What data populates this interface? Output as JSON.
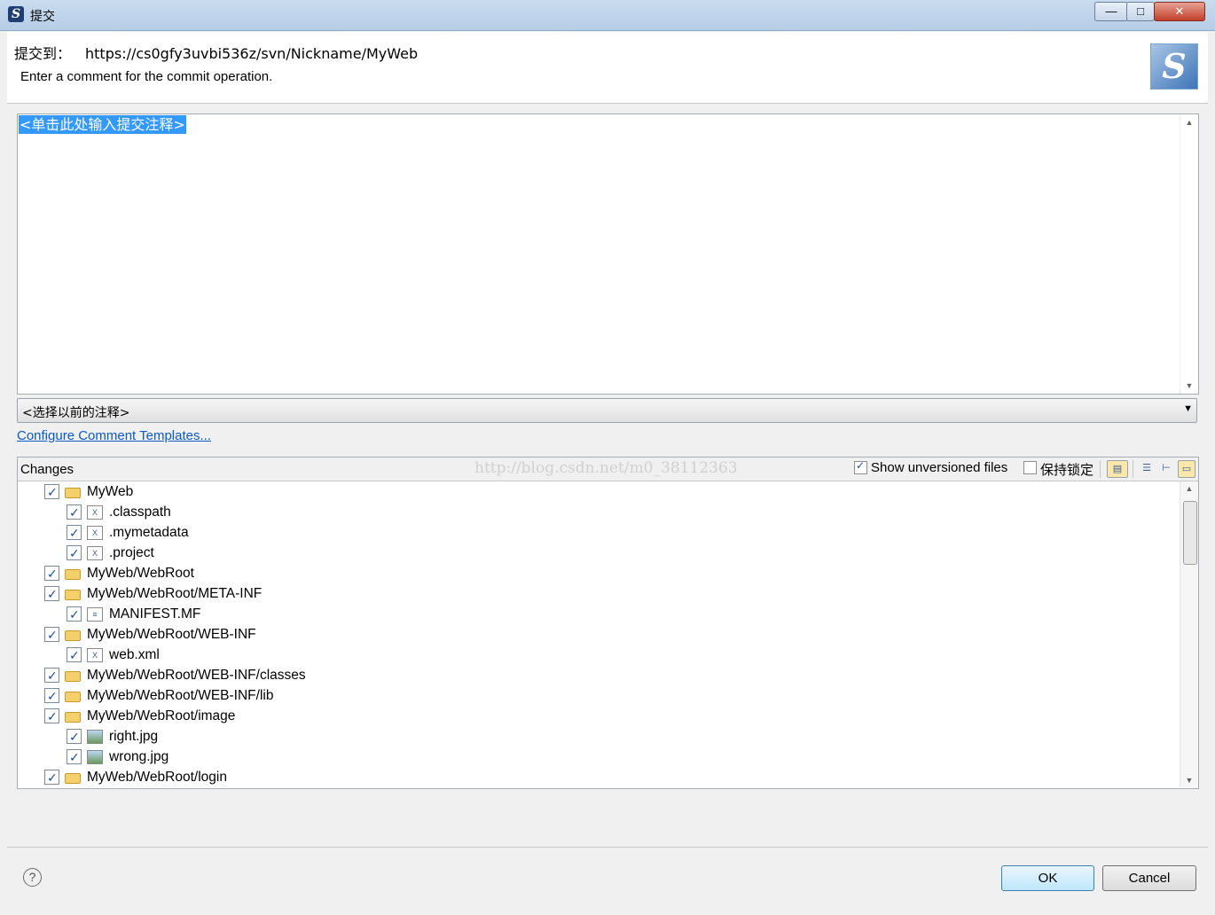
{
  "window": {
    "title": "提交",
    "app_icon": "svn-icon",
    "minimize": "—",
    "maximize": "□",
    "close": "✕"
  },
  "header": {
    "commit_to_label": "提交到：",
    "commit_to_url": "https://cs0gfy3uvbi536z/svn/Nickname/MyWeb",
    "description": "Enter a comment for the commit operation.",
    "logo": "svn-logo"
  },
  "comment": {
    "placeholder": "<单击此处输入提交注释>"
  },
  "previous_comments": {
    "selected": "<选择以前的注释>"
  },
  "configure_link": "Configure Comment Templates...",
  "changes": {
    "label": "Changes",
    "watermark": "http://blog.csdn.net/m0_38112363",
    "show_unversioned_label": "Show unversioned files",
    "show_unversioned_checked": true,
    "keep_locks_label": "保持锁定",
    "keep_locks_checked": false,
    "items": [
      {
        "text": "MyWeb",
        "level": 0,
        "icon": "project-folder-icon",
        "checked": true
      },
      {
        "text": ".classpath",
        "level": 1,
        "icon": "xml-file-icon",
        "checked": true
      },
      {
        "text": ".mymetadata",
        "level": 1,
        "icon": "xml-file-icon",
        "checked": true
      },
      {
        "text": ".project",
        "level": 1,
        "icon": "xml-file-icon",
        "checked": true
      },
      {
        "text": "MyWeb/WebRoot",
        "level": 0,
        "icon": "folder-icon",
        "checked": true
      },
      {
        "text": "MyWeb/WebRoot/META-INF",
        "level": 0,
        "icon": "folder-icon",
        "checked": true
      },
      {
        "text": "MANIFEST.MF",
        "level": 1,
        "icon": "text-file-icon",
        "checked": true
      },
      {
        "text": "MyWeb/WebRoot/WEB-INF",
        "level": 0,
        "icon": "folder-icon",
        "checked": true
      },
      {
        "text": "web.xml",
        "level": 1,
        "icon": "xml-file-icon",
        "checked": true
      },
      {
        "text": "MyWeb/WebRoot/WEB-INF/classes",
        "level": 0,
        "icon": "folder-icon",
        "checked": true
      },
      {
        "text": "MyWeb/WebRoot/WEB-INF/lib",
        "level": 0,
        "icon": "folder-icon",
        "checked": true
      },
      {
        "text": "MyWeb/WebRoot/image",
        "level": 0,
        "icon": "folder-icon",
        "checked": true
      },
      {
        "text": "right.jpg",
        "level": 1,
        "icon": "image-file-icon",
        "checked": true
      },
      {
        "text": "wrong.jpg",
        "level": 1,
        "icon": "image-file-icon",
        "checked": true
      },
      {
        "text": "MyWeb/WebRoot/login",
        "level": 0,
        "icon": "folder-icon",
        "checked": true
      }
    ]
  },
  "buttons": {
    "help": "?",
    "ok": "OK",
    "cancel": "Cancel"
  },
  "colors": {
    "selection": "#3399ff",
    "link": "#0a5ac8"
  }
}
